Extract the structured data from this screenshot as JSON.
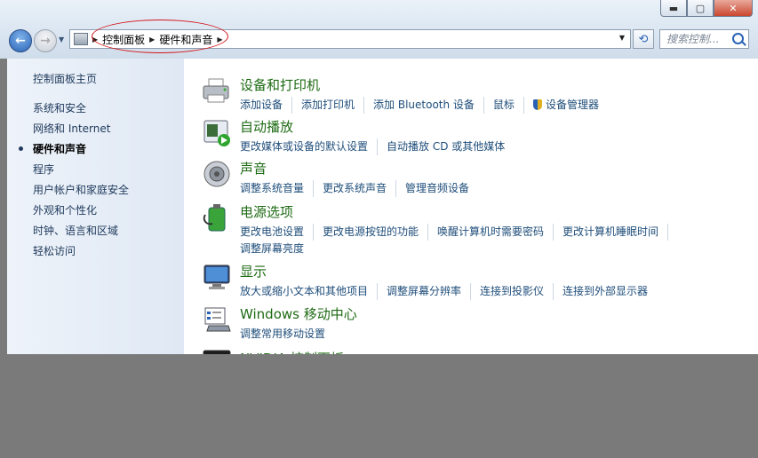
{
  "address": {
    "crumbs": [
      "控制面板",
      "硬件和声音"
    ]
  },
  "search": {
    "placeholder": "搜索控制..."
  },
  "window_buttons": {
    "minimize": "▬",
    "maximize": "▢",
    "close": "✕"
  },
  "sidebar": {
    "items": [
      {
        "label": "控制面板主页",
        "active": false
      },
      {
        "label": "系统和安全",
        "active": false
      },
      {
        "label": "网络和 Internet",
        "active": false
      },
      {
        "label": "硬件和声音",
        "active": true
      },
      {
        "label": "程序",
        "active": false
      },
      {
        "label": "用户帐户和家庭安全",
        "active": false
      },
      {
        "label": "外观和个性化",
        "active": false
      },
      {
        "label": "时钟、语言和区域",
        "active": false
      },
      {
        "label": "轻松访问",
        "active": false
      }
    ]
  },
  "categories": [
    {
      "title": "设备和打印机",
      "icon": "printer-icon",
      "links": [
        "添加设备",
        "添加打印机",
        "添加 Bluetooth 设备",
        "鼠标",
        "设备管理器"
      ]
    },
    {
      "title": "自动播放",
      "icon": "autoplay-icon",
      "links": [
        "更改媒体或设备的默认设置",
        "自动播放 CD 或其他媒体"
      ]
    },
    {
      "title": "声音",
      "icon": "speaker-icon",
      "links": [
        "调整系统音量",
        "更改系统声音",
        "管理音频设备"
      ]
    },
    {
      "title": "电源选项",
      "icon": "battery-icon",
      "links": [
        "更改电池设置",
        "更改电源按钮的功能",
        "唤醒计算机时需要密码",
        "更改计算机睡眠时间"
      ],
      "links2": [
        "调整屏幕亮度"
      ]
    },
    {
      "title": "显示",
      "icon": "monitor-icon",
      "links": [
        "放大或缩小文本和其他项目",
        "调整屏幕分辨率",
        "连接到投影仪",
        "连接到外部显示器"
      ]
    },
    {
      "title": "Windows 移动中心",
      "icon": "mobility-center-icon",
      "links": [
        "调整常用移动设置"
      ]
    },
    {
      "title": "NVIDIA 控制面板",
      "icon": "nvidia-icon",
      "links": []
    }
  ],
  "colors": {
    "accent": "#1e6b14",
    "link": "#1e4d7a",
    "annotation": "#d3161b"
  }
}
